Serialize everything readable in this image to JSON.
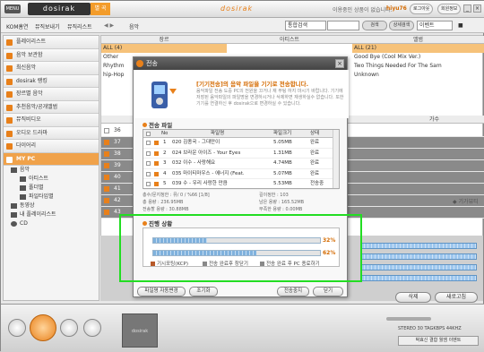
{
  "app": {
    "menu_label": "MENU",
    "logo_text": "dosirak",
    "tab_label": "별 곡",
    "center_logo": "dosirak",
    "notice": "이용중인 상품이 없습니다.",
    "user": "hiyu76",
    "logout_label": "로그아웃",
    "myinfo_label": "회원정보"
  },
  "navbar": {
    "items": [
      "KOM홈연",
      "뮤직보내기",
      "뮤직리스트"
    ],
    "crumb": "음악",
    "search_scope": "통합검색",
    "search_btn": "검색",
    "detail_btn": "상세검색",
    "event_select": "이벤트"
  },
  "sidebar": {
    "items": [
      "플레이리스트",
      "음악 보관함",
      "최신음악",
      "dosirak 랭킹",
      "장르별 음악",
      "추천음악/공개앨범",
      "뮤직비디오",
      "오디오 드라마",
      "다이어리"
    ],
    "active": "MY PC",
    "tree": [
      "음악",
      "아티스트",
      "폴더별",
      "파일타입별",
      "동영상",
      "내 플레이리스트",
      "CD"
    ]
  },
  "browser": {
    "col_genre": "장르",
    "col_artist": "아티스트",
    "col_album": "앨범",
    "genres": [
      "ALL (4)",
      "Other",
      "Rhythm",
      "hip-Hop"
    ],
    "albums": [
      "ALL (21)",
      "Good Bye (Cool Mix Ver.)",
      "Two Things Needed For The Sam",
      "Unknown"
    ],
    "col_singer": "가수",
    "row_numbers": [
      "36",
      "37",
      "38",
      "39",
      "40",
      "41",
      "42",
      "43"
    ],
    "view_label": "기가뷰티"
  },
  "actions": {
    "delete": "삭제",
    "refresh": "새로고침"
  },
  "player": {
    "album_label": "dosirak",
    "eq_text": "STEREO 30 TAGKBPS 44KHZ",
    "ticker": "박효신 결합 월엠 이벤트"
  },
  "dialog": {
    "title": "전송",
    "msg_title": "[기기전송]의 음악 파일을 기기로 전송합니다.",
    "msg_body": "음악파일 전송 도중 PC의 전원을 끄거나 재 부팅 하지 마시기 바랍니다. 기기에 저장된 음악파일의 파일명을 변경하시거나 삭제하면 재생하실수 없습니다. 또한 기기를 연결하신 후 dosirak으로 변경하실 수 있습니다.",
    "files_section": "전송 파일",
    "headers": {
      "no": "No",
      "file": "파일명",
      "size": "파일크기",
      "status": "상태"
    },
    "files": [
      {
        "no": "1",
        "name": "020 김종국 - 그대만이",
        "size": "5.05MB",
        "status": "완료"
      },
      {
        "no": "2",
        "name": "024 브라운 아이즈 - Your Eyes",
        "size": "1.31MB",
        "status": "완료"
      },
      {
        "no": "3",
        "name": "032 이수 - 사랑해요",
        "size": "4.74MB",
        "status": "완료"
      },
      {
        "no": "4",
        "name": "035 마이티마우스 - 에너지 (Feat.",
        "size": "5.07MB",
        "status": "완료"
      },
      {
        "no": "5",
        "name": "039 수 - 우리 사랑한 만큼",
        "size": "5.53MB",
        "status": "전송중"
      }
    ],
    "sum_lines": [
      "총수/문지청한 : 뮤/ 0 / %66 [1/8]",
      "총 용량 : 236.95MB",
      "전송할 용량 : 30.88MB"
    ],
    "sum_right": [
      "길이정한 : 103",
      "남은 용량 : 165.52MB",
      "부족한 용량 : 0.00MB"
    ],
    "progress_section": "진행 상황",
    "progress1_pct": "32%",
    "progress1_val": 0.32,
    "progress2_pct": "62%",
    "progress2_val": 0.62,
    "legend": [
      "기시포팅(KCP)",
      "전송 완료후 창닫기",
      "전송 완료 후 PC 종료하기"
    ],
    "btn_settings": "파일명 자동변경",
    "btn_cancel": "조기화",
    "btn_stop": "전송중지",
    "btn_close": "닫기"
  },
  "colors": {
    "accent": "#e8801a",
    "highlight": "#22dd22"
  }
}
